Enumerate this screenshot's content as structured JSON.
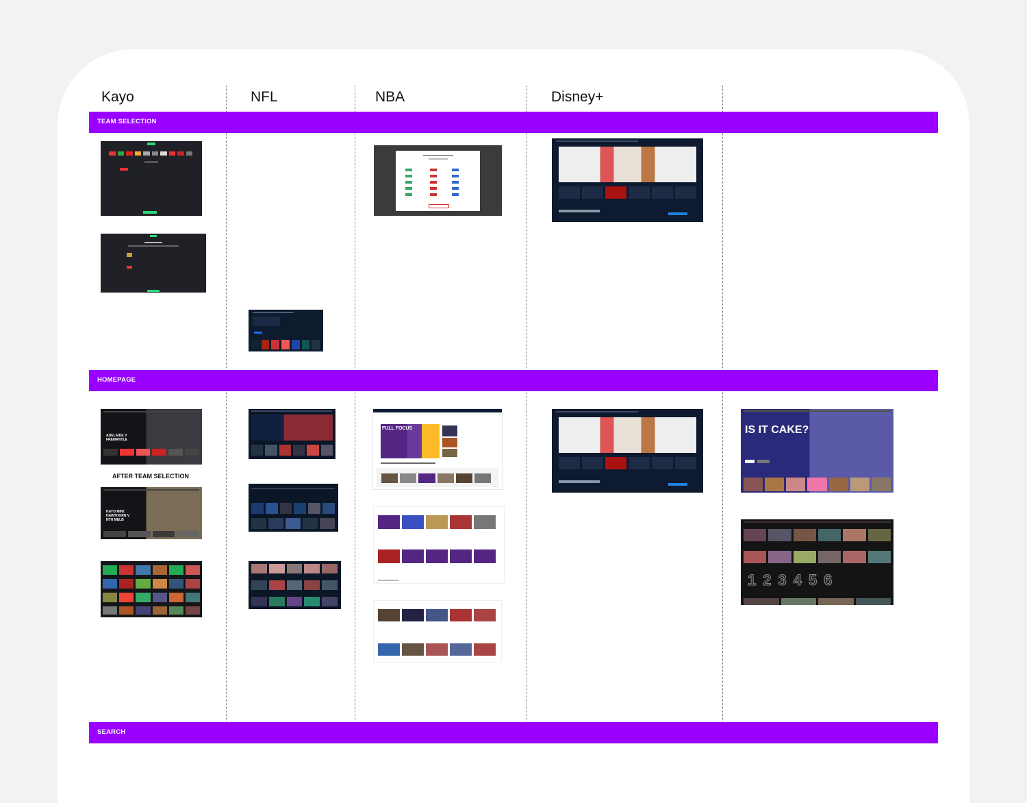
{
  "columns": [
    "Kayo",
    "NFL",
    "NBA",
    "Disney+"
  ],
  "sections": {
    "team_selection": "TEAM SELECTION",
    "homepage": "HOMEPAGE",
    "search": "SEARCH"
  },
  "kayo": {
    "after_team_selection": "AFTER TEAM SELECTION",
    "hero1": "ADELAIDE V FREMANTLE",
    "hero2": "KAYO MINI: HAWTHORN V NTH MELB"
  },
  "nba": {
    "full_focus": "FULL FOCUS"
  },
  "netflix": {
    "hero_title": "IS IT CAKE?",
    "top_numbers": [
      "1",
      "2",
      "3",
      "4",
      "5",
      "6"
    ]
  },
  "disney": {
    "brands": [
      "Disney",
      "PIXAR",
      "MARVEL",
      "STAR WARS",
      "NAT GEO",
      "STAR"
    ],
    "sharing": "Sharing Disney+ with family?"
  },
  "colors": {
    "band": "#9900ff",
    "kayo_green": "#2fd67a",
    "nba_purple": "#552583",
    "netflix_red": "#e50914"
  }
}
